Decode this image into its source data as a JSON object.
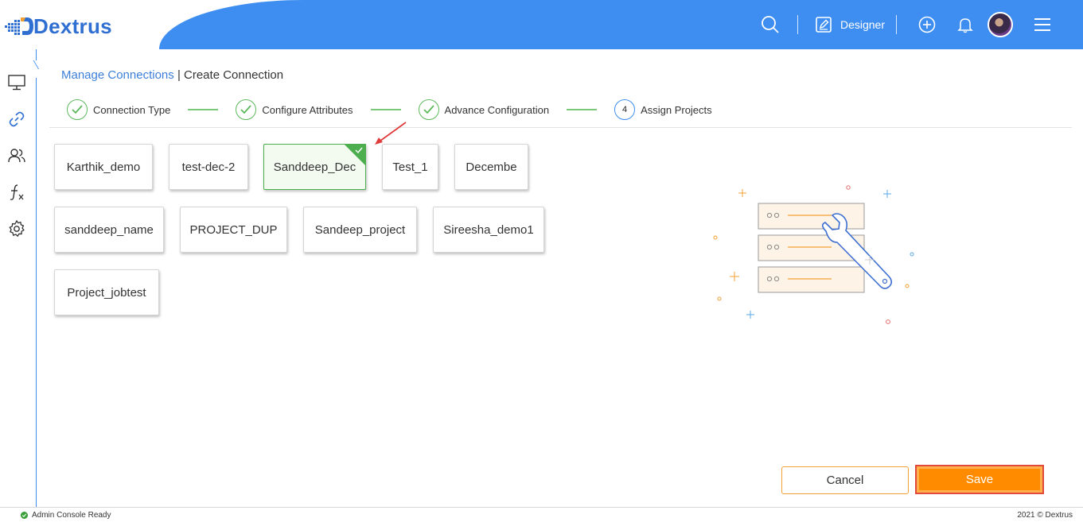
{
  "app": {
    "logo_text": "Dextrus"
  },
  "header": {
    "designer_label": "Designer",
    "icons": [
      "search-icon",
      "edit-icon",
      "add-circle-icon",
      "bell-icon",
      "avatar",
      "menu-icon"
    ]
  },
  "sidebar": {
    "items": [
      "monitor-icon",
      "link-icon",
      "users-icon",
      "function-icon",
      "gear-icon"
    ],
    "active": "link-icon"
  },
  "breadcrumb": {
    "parent": "Manage Connections",
    "separator": "|",
    "current": "Create Connection"
  },
  "stepper": {
    "steps": [
      {
        "label": "Connection Type",
        "state": "done"
      },
      {
        "label": "Configure Attributes",
        "state": "done"
      },
      {
        "label": "Advance Configuration",
        "state": "done"
      },
      {
        "label": "Assign Projects",
        "state": "current",
        "number": "4"
      }
    ]
  },
  "projects": [
    {
      "name": "Karthik_demo",
      "selected": false
    },
    {
      "name": "test-dec-2",
      "selected": false
    },
    {
      "name": "Sanddeep_Dec",
      "selected": true
    },
    {
      "name": "Test_1",
      "selected": false
    },
    {
      "name": "Decembe",
      "selected": false
    },
    {
      "name": "sanddeep_name",
      "selected": false
    },
    {
      "name": "PROJECT_DUP",
      "selected": false
    },
    {
      "name": "Sandeep_project",
      "selected": false
    },
    {
      "name": "Sireesha_demo1",
      "selected": false
    },
    {
      "name": "Project_jobtest",
      "selected": false
    }
  ],
  "actions": {
    "cancel_label": "Cancel",
    "save_label": "Save"
  },
  "footer": {
    "status": "Admin Console Ready",
    "copyright": "2021 © Dextrus"
  },
  "colors": {
    "brand_blue": "#3d8ef0",
    "success_green": "#5cb85c",
    "save_orange": "#ff8c00",
    "highlight_red": "#e14a3b"
  }
}
